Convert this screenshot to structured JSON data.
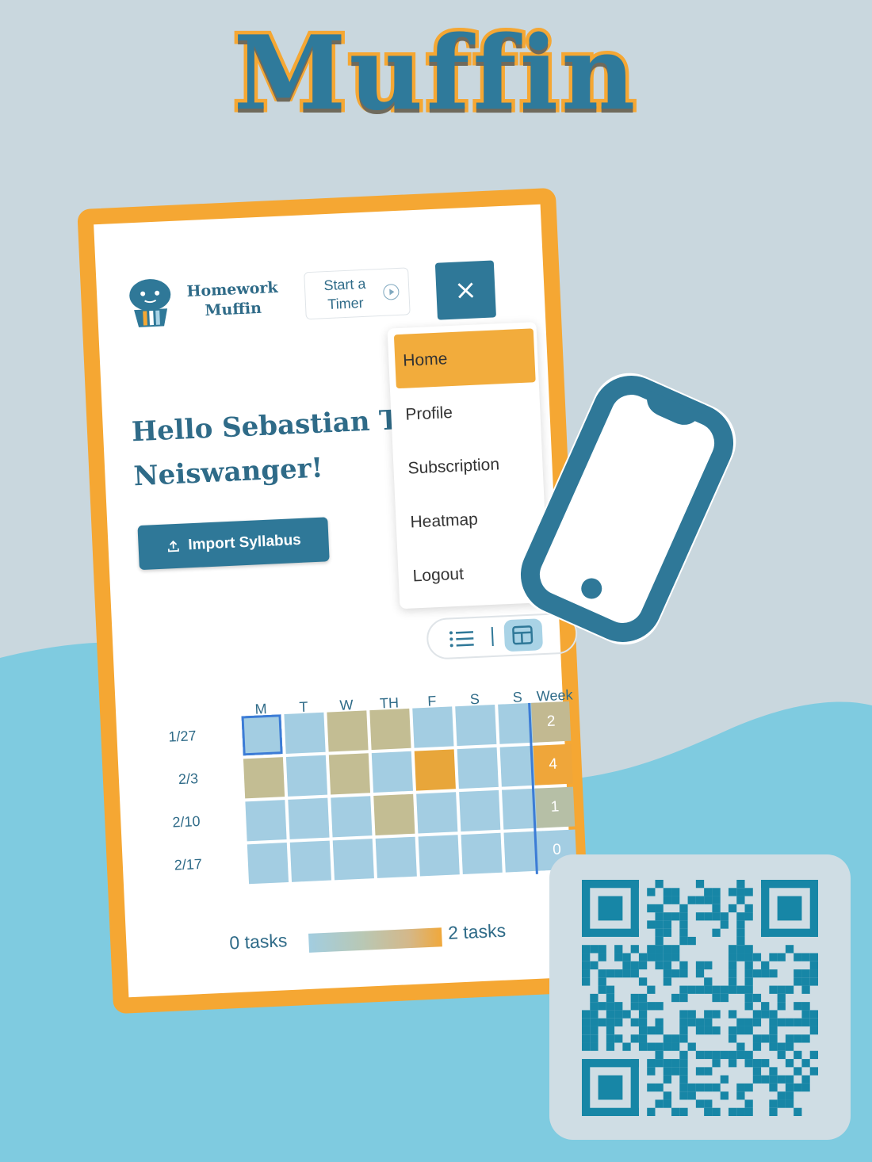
{
  "poster": {
    "title": "Muffin"
  },
  "app": {
    "brand_line1": "Homework",
    "brand_line2": "Muffin",
    "timer_button": "Start a Timer",
    "close_icon": "×",
    "greeting_line1": "Hello Sebastian T.",
    "greeting_line2": "Neiswanger!",
    "import_button": "Import Syllabus",
    "menu": {
      "items": [
        {
          "label": "Home",
          "active": true
        },
        {
          "label": "Profile",
          "active": false
        },
        {
          "label": "Subscription",
          "active": false
        },
        {
          "label": "Heatmap",
          "active": false
        },
        {
          "label": "Logout",
          "active": false
        }
      ]
    },
    "view_toggle": {
      "icons": [
        "list-icon",
        "grid-icon"
      ],
      "selected": "grid-icon"
    },
    "heatmap": {
      "days": [
        "M",
        "T",
        "W",
        "TH",
        "F",
        "S",
        "S"
      ],
      "week_header": "Week",
      "rows": [
        {
          "label": "1/27",
          "cells": [
            0,
            0,
            1,
            1,
            0,
            0,
            0
          ],
          "week_total": "2"
        },
        {
          "label": "2/3",
          "cells": [
            1,
            0,
            1,
            0,
            2,
            0,
            0
          ],
          "week_total": "4"
        },
        {
          "label": "2/10",
          "cells": [
            0,
            0,
            0,
            1,
            0,
            0,
            0
          ],
          "week_total": "1"
        },
        {
          "label": "2/17",
          "cells": [
            0,
            0,
            0,
            0,
            0,
            0,
            0
          ],
          "week_total": "0"
        }
      ],
      "legend_min": "0 tasks",
      "legend_max": "2 tasks",
      "colors": {
        "zero": "#a3cde2",
        "one": "#c3bd93",
        "two": "#e8a63a"
      },
      "week_colors": {
        "2": "#c2b991",
        "4": "#efa63a",
        "1": "#b6bfa6",
        "0": "#a3cde2"
      }
    }
  },
  "colors": {
    "accent_blue": "#2f7898",
    "accent_orange": "#f5a733",
    "background": "#c9d7de",
    "wave": "#7fcbe0"
  }
}
